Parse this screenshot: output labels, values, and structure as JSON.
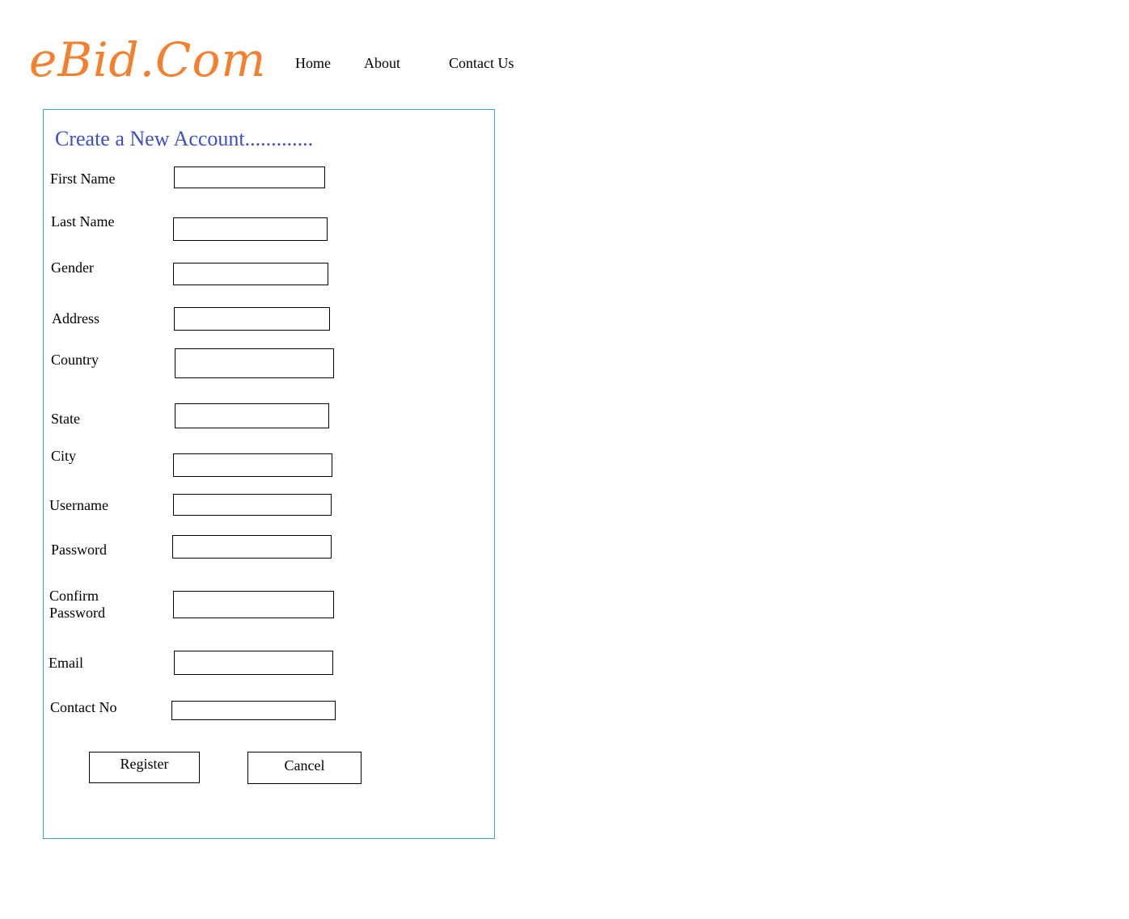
{
  "header": {
    "logo": "eBid.Com",
    "nav": {
      "home": "Home",
      "about": "About",
      "contact": "Contact Us"
    }
  },
  "form": {
    "title": "Create a New Account.............",
    "fields": {
      "first_name": {
        "label": "First Name",
        "value": ""
      },
      "last_name": {
        "label": "Last Name",
        "value": ""
      },
      "gender": {
        "label": "Gender",
        "value": ""
      },
      "address": {
        "label": "Address",
        "value": ""
      },
      "country": {
        "label": "Country",
        "value": ""
      },
      "state": {
        "label": "State",
        "value": ""
      },
      "city": {
        "label": "City",
        "value": ""
      },
      "username": {
        "label": "Username",
        "value": ""
      },
      "password": {
        "label": "Password",
        "value": ""
      },
      "confirm_password": {
        "label_line1": "Confirm",
        "label_line2": "Password",
        "value": ""
      },
      "email": {
        "label": "Email",
        "value": ""
      },
      "contact_no": {
        "label": "Contact No",
        "value": ""
      }
    },
    "buttons": {
      "register": "Register",
      "cancel": "Cancel"
    }
  },
  "colors": {
    "logo": "#f47f2c",
    "title": "#3c4fc9",
    "panel_border": "#3aa7b9"
  }
}
